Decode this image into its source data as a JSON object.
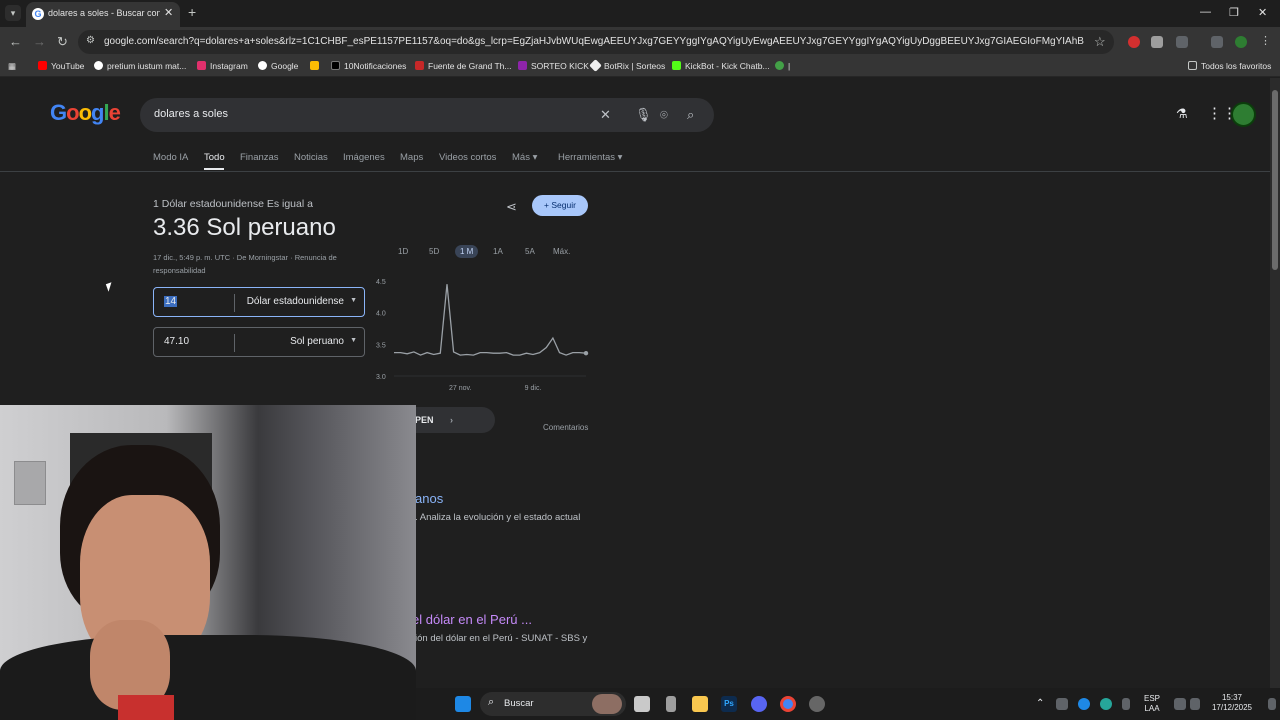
{
  "browser": {
    "tab_title": "dolares a soles - Buscar con Google",
    "url": "google.com/search?q=dolares+a+soles&rlz=1C1CHBF_esPE1157PE1157&oq=do&gs_lcrp=EgZjaHJvbWUqEwgAEEUYJxg7GEYYggIYgAQYigUyEwgAEEUYJxg7GEYYggIYgAQYigUyDggBEEUYJxg7GIAEGIoFMgYIAhBFGDsyBggDEEUYQDIGCAQ...",
    "bookmarks": [
      "YouTube",
      "pretium iustum mat...",
      "Instagram",
      "Google",
      "10Notificaciones",
      "Fuente de Grand Th...",
      "SORTEO KICK",
      "BotRix | Sorteos",
      "KickBot - Kick Chatb...",
      "Todos los favoritos"
    ]
  },
  "google": {
    "logo": "Google",
    "query": "dolares a soles",
    "tabs": [
      "Modo IA",
      "Todo",
      "Finanzas",
      "Noticias",
      "Imágenes",
      "Maps",
      "Videos cortos",
      "Más ▾",
      "Herramientas ▾"
    ],
    "active_tab": "Todo"
  },
  "converter": {
    "equal_label": "1 Dólar estadounidense Es igual a",
    "result": "3.36 Sol peruano",
    "timestamp": "17 dic., 5:49 p. m. UTC · De Morningstar · Renuncia de responsabilidad",
    "follow_label": "+ Seguir",
    "from_value": "14",
    "from_unit": "Dólar estadounidense",
    "to_value": "47.10",
    "to_unit": "Sol peruano",
    "pen_label": "PEN",
    "comments": "Comentarios"
  },
  "chart_data": {
    "type": "line",
    "ranges": [
      "1D",
      "5D",
      "1 M",
      "1A",
      "5A",
      "Máx."
    ],
    "active_range": "1 M",
    "yticks": [
      "4.5",
      "4.0",
      "3.5",
      "3.0"
    ],
    "ylim": [
      3.0,
      4.5
    ],
    "xticks": [
      "27 nov.",
      "9 dic."
    ],
    "series": [
      {
        "values": [
          3.37,
          3.37,
          3.35,
          3.38,
          3.33,
          3.37,
          3.34,
          3.36,
          4.45,
          3.38,
          3.33,
          3.34,
          3.33,
          3.37,
          3.37,
          3.36,
          3.36,
          3.37,
          3.33,
          3.33,
          3.36,
          3.34,
          3.37,
          3.45,
          3.6,
          3.37,
          3.33,
          3.37,
          3.37,
          3.36
        ]
      }
    ],
    "color": "#9aa0a6"
  },
  "results": {
    "r1_title": "anos",
    "r1_snippet": ". Analiza la evolución y el estado actual",
    "r2_title": "el dólar en el Perú ...",
    "r2_snippet": "ión del dólar en el Perú - SUNAT - SBS y"
  },
  "taskbar": {
    "search": "Buscar",
    "lang": "ESP\nLAA",
    "time": "15:37",
    "date": "17/12/2025"
  }
}
